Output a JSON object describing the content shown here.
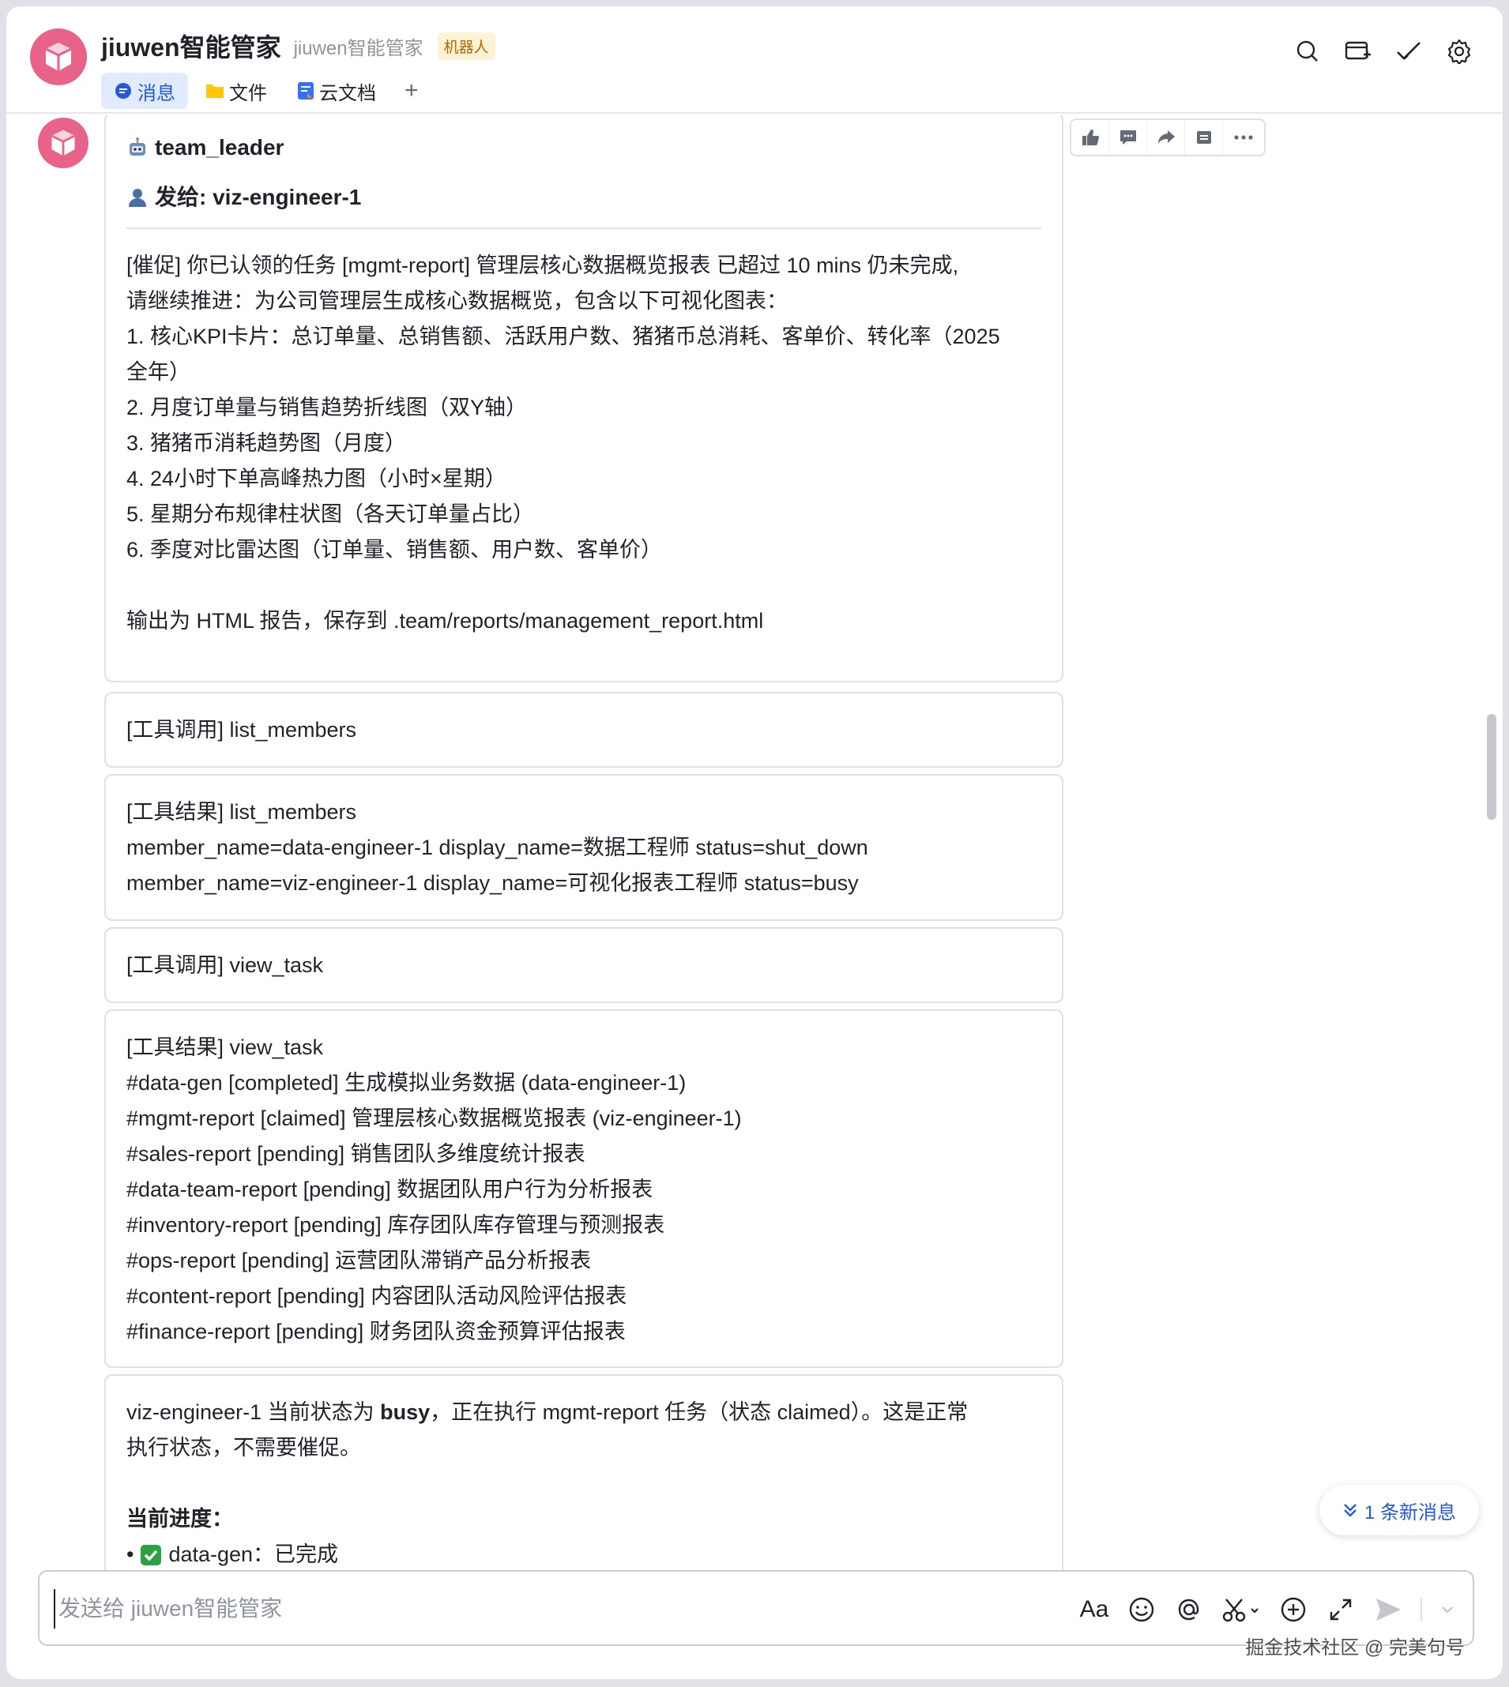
{
  "header": {
    "title": "jiuwen智能管家",
    "subtitle": "jiuwen智能管家",
    "badge": "机器人",
    "tabs": [
      {
        "label": "消息",
        "icon": "chat-bubble-icon"
      },
      {
        "label": "文件",
        "icon": "folder-icon"
      },
      {
        "label": "云文档",
        "icon": "doc-icon"
      }
    ],
    "add_tab": "+",
    "actions": [
      "search-icon",
      "add-chat-icon",
      "checkmark-icon",
      "gear-icon"
    ]
  },
  "message_toolbar": [
    "thumbs-up-icon",
    "comment-icon",
    "forward-icon",
    "pin-icon",
    "more-icon"
  ],
  "cards": {
    "c1": {
      "sender": "team_leader",
      "recipient": "发给: viz-engineer-1",
      "lines": [
        "[催促] 你已认领的任务 [mgmt-report] 管理层核心数据概览报表 已超过 10 mins 仍未完成,",
        "请继续推进：为公司管理层生成核心数据概览，包含以下可视化图表：",
        "1. 核心KPI卡片：总订单量、总销售额、活跃用户数、猪猪币总消耗、客单价、转化率（2025",
        "全年）",
        "2. 月度订单量与销售趋势折线图（双Y轴）",
        "3. 猪猪币消耗趋势图（月度）",
        "4. 24小时下单高峰热力图（小时×星期）",
        "5. 星期分布规律柱状图（各天订单量占比）",
        "6. 季度对比雷达图（订单量、销售额、用户数、客单价）",
        "",
        "输出为 HTML 报告，保存到 .team/reports/management_report.html"
      ]
    },
    "c2": {
      "lines": [
        "[工具调用] list_members"
      ]
    },
    "c3": {
      "lines": [
        "[工具结果] list_members",
        "member_name=data-engineer-1 display_name=数据工程师 status=shut_down",
        "member_name=viz-engineer-1 display_name=可视化报表工程师 status=busy"
      ]
    },
    "c4": {
      "lines": [
        "[工具调用] view_task"
      ]
    },
    "c5": {
      "lines": [
        "[工具结果] view_task",
        "#data-gen [completed] 生成模拟业务数据 (data-engineer-1)",
        "#mgmt-report [claimed] 管理层核心数据概览报表 (viz-engineer-1)",
        "#sales-report [pending] 销售团队多维度统计报表",
        "#data-team-report [pending] 数据团队用户行为分析报表",
        "#inventory-report [pending] 库存团队库存管理与预测报表",
        "#ops-report [pending] 运营团队滞销产品分析报表",
        "#content-report [pending] 内容团队活动风险评估报表",
        "#finance-report [pending] 财务团队资金预算评估报表"
      ]
    },
    "c6": {
      "l1_pre": "viz-engineer-1 当前状态为 ",
      "l1_bold": "busy",
      "l1_post": "，正在执行 mgmt-report 任务（状态 claimed）。这是正常",
      "l2": "执行状态，不需要催促。",
      "progress_title": "当前进度：",
      "bullet": "•",
      "item_text": "data-gen：已完成"
    }
  },
  "new_messages": "1 条新消息",
  "composer": {
    "placeholder": "发送给 jiuwen智能管家",
    "icons": [
      "text-format-icon",
      "emoji-icon",
      "at-mention-icon",
      "scissors-icon",
      "add-circle-icon",
      "expand-icon",
      "send-icon",
      "chevron-down-icon"
    ],
    "format_label": "Aa"
  },
  "watermark": "掘金技术社区 @ 完美句号",
  "colors": {
    "accent": "#245bdb",
    "avatar": "#e9628a",
    "badge_bg": "#fdf1d6",
    "badge_text": "#b26a00"
  }
}
